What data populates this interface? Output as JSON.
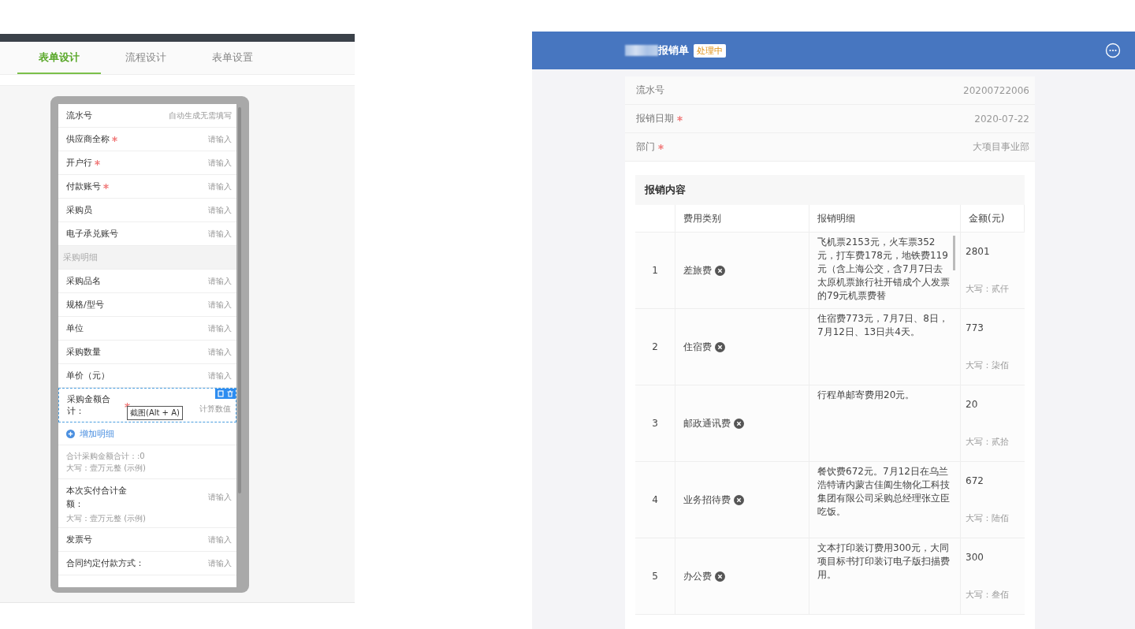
{
  "designer": {
    "tabs": [
      {
        "label": "表单设计",
        "selected": true
      },
      {
        "label": "流程设计",
        "selected": false
      },
      {
        "label": "表单设置",
        "selected": false
      }
    ],
    "form_items": [
      {
        "kind": "field",
        "label": "流水号",
        "required": false,
        "hint": "自动生成无需填写"
      },
      {
        "kind": "field",
        "label": "供应商全称",
        "required": true,
        "hint": "请输入"
      },
      {
        "kind": "field",
        "label": "开户行",
        "required": true,
        "hint": "请输入"
      },
      {
        "kind": "field",
        "label": "付款账号",
        "required": true,
        "hint": "请输入"
      },
      {
        "kind": "field",
        "label": "采购员",
        "required": false,
        "hint": "请输入"
      },
      {
        "kind": "field",
        "label": "电子承兑账号",
        "required": false,
        "hint": "请输入"
      },
      {
        "kind": "section",
        "label": "采购明细"
      },
      {
        "kind": "field",
        "label": "采购品名",
        "required": false,
        "hint": "请输入"
      },
      {
        "kind": "field",
        "label": "规格/型号",
        "required": false,
        "hint": "请输入"
      },
      {
        "kind": "field",
        "label": "单位",
        "required": false,
        "hint": "请输入"
      },
      {
        "kind": "field",
        "label": "采购数量",
        "required": false,
        "hint": "请输入"
      },
      {
        "kind": "field",
        "label": "单价（元）",
        "required": false,
        "hint": "请输入"
      },
      {
        "kind": "selected",
        "label": "采购金额合计：",
        "required": true,
        "hint": "计算数值",
        "tooltip": "截图(Alt + A)"
      },
      {
        "kind": "add",
        "label": "增加明细"
      },
      {
        "kind": "summary",
        "lines": [
          "合计采购金额合计：:0",
          "大写：壹万元整 (示例)"
        ]
      },
      {
        "kind": "noted",
        "label": "本次实付合计金额：",
        "required": false,
        "hint": "请输入",
        "note": "大写：壹万元整 (示例)"
      },
      {
        "kind": "field",
        "label": "发票号",
        "required": false,
        "hint": "请输入"
      },
      {
        "kind": "field",
        "label": "合同约定付款方式：",
        "required": false,
        "hint": "请输入"
      }
    ]
  },
  "expense_form": {
    "title": "报销单",
    "status": "处理中",
    "fields": [
      {
        "label": "流水号",
        "required": false,
        "value": "20200722006"
      },
      {
        "label": "报销日期",
        "required": true,
        "value": "2020-07-22"
      },
      {
        "label": "部门",
        "required": true,
        "value": "大项目事业部"
      }
    ],
    "table": {
      "title": "报销内容",
      "columns": [
        "费用类别",
        "报销明细",
        "金额(元)"
      ],
      "rows": [
        {
          "no": "1",
          "category": "差旅费",
          "detail": "飞机票2153元，火车票352元，打车费178元，地铁费119元（含上海公交，含7月7日去太原机票旅行社开错成个人发票的79元机票费替",
          "amount": "2801",
          "amount_words": "大写：贰仟"
        },
        {
          "no": "2",
          "category": "住宿费",
          "detail": "住宿费773元，7月7日、8日，7月12日、13日共4天。",
          "amount": "773",
          "amount_words": "大写：柒佰"
        },
        {
          "no": "3",
          "category": "邮政通讯费",
          "detail": "行程单邮寄费用20元。",
          "amount": "20",
          "amount_words": "大写：贰拾"
        },
        {
          "no": "4",
          "category": "业务招待费",
          "detail": "餐饮费672元。7月12日在乌兰浩特请内蒙古佳阖生物化工科技集团有限公司采购总经理张立臣吃饭。",
          "amount": "672",
          "amount_words": "大写：陆佰"
        },
        {
          "no": "5",
          "category": "办公费",
          "detail": "文本打印装订费用300元，大同项目标书打印装订电子版扫描费用。",
          "amount": "300",
          "amount_words": "大写：叁佰"
        }
      ]
    }
  }
}
